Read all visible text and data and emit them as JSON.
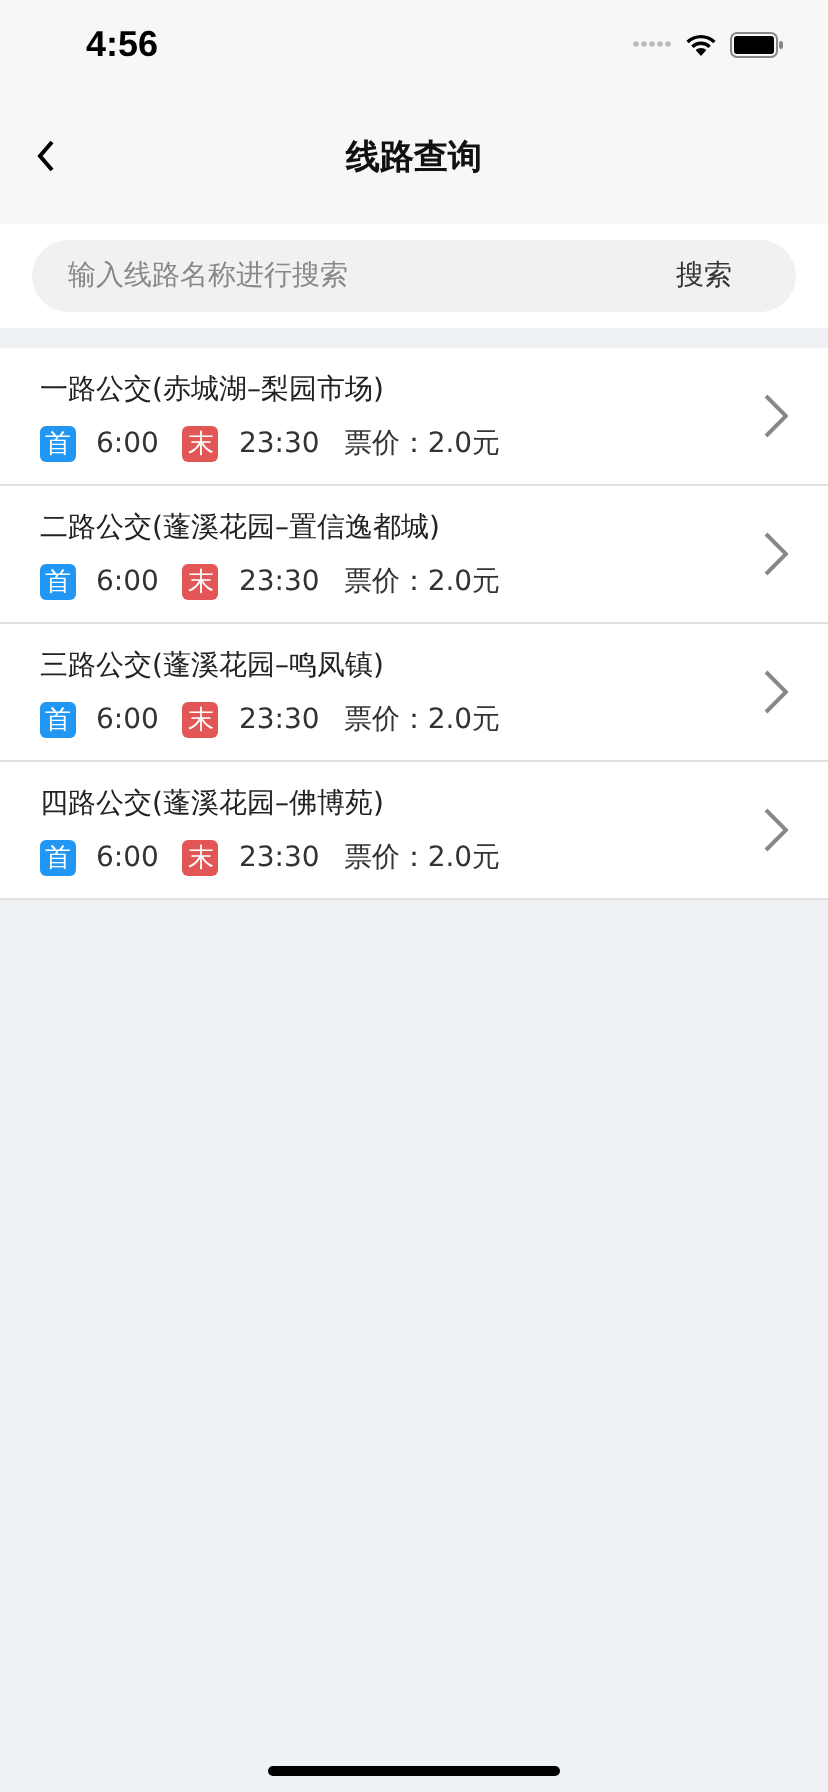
{
  "status_bar": {
    "time": "4:56"
  },
  "nav": {
    "title": "线路查询"
  },
  "search": {
    "placeholder": "输入线路名称进行搜索",
    "button": "搜索"
  },
  "routes": [
    {
      "name": "一路公交(赤城湖–梨园市场)",
      "first": {
        "label": "首",
        "time": "6:00",
        "color": "#2196f3"
      },
      "last": {
        "label": "末",
        "time": "23:30",
        "color": "#e25656"
      },
      "price": "票价：2.0元"
    },
    {
      "name": "二路公交(蓬溪花园–置信逸都城)",
      "first": {
        "label": "首",
        "time": "6:00",
        "color": "#2196f3"
      },
      "last": {
        "label": "末",
        "time": "23:30",
        "color": "#e25656"
      },
      "price": "票价：2.0元"
    },
    {
      "name": "三路公交(蓬溪花园–鸣凤镇)",
      "first": {
        "label": "首",
        "time": "6:00",
        "color": "#2196f3"
      },
      "last": {
        "label": "末",
        "time": "23:30",
        "color": "#e25656"
      },
      "price": "票价：2.0元"
    },
    {
      "name": "四路公交(蓬溪花园–佛博苑)",
      "first": {
        "label": "首",
        "time": "6:00",
        "color": "#2196f3"
      },
      "last": {
        "label": "末",
        "time": "23:30",
        "color": "#e25656"
      },
      "price": "票价：2.0元"
    }
  ]
}
